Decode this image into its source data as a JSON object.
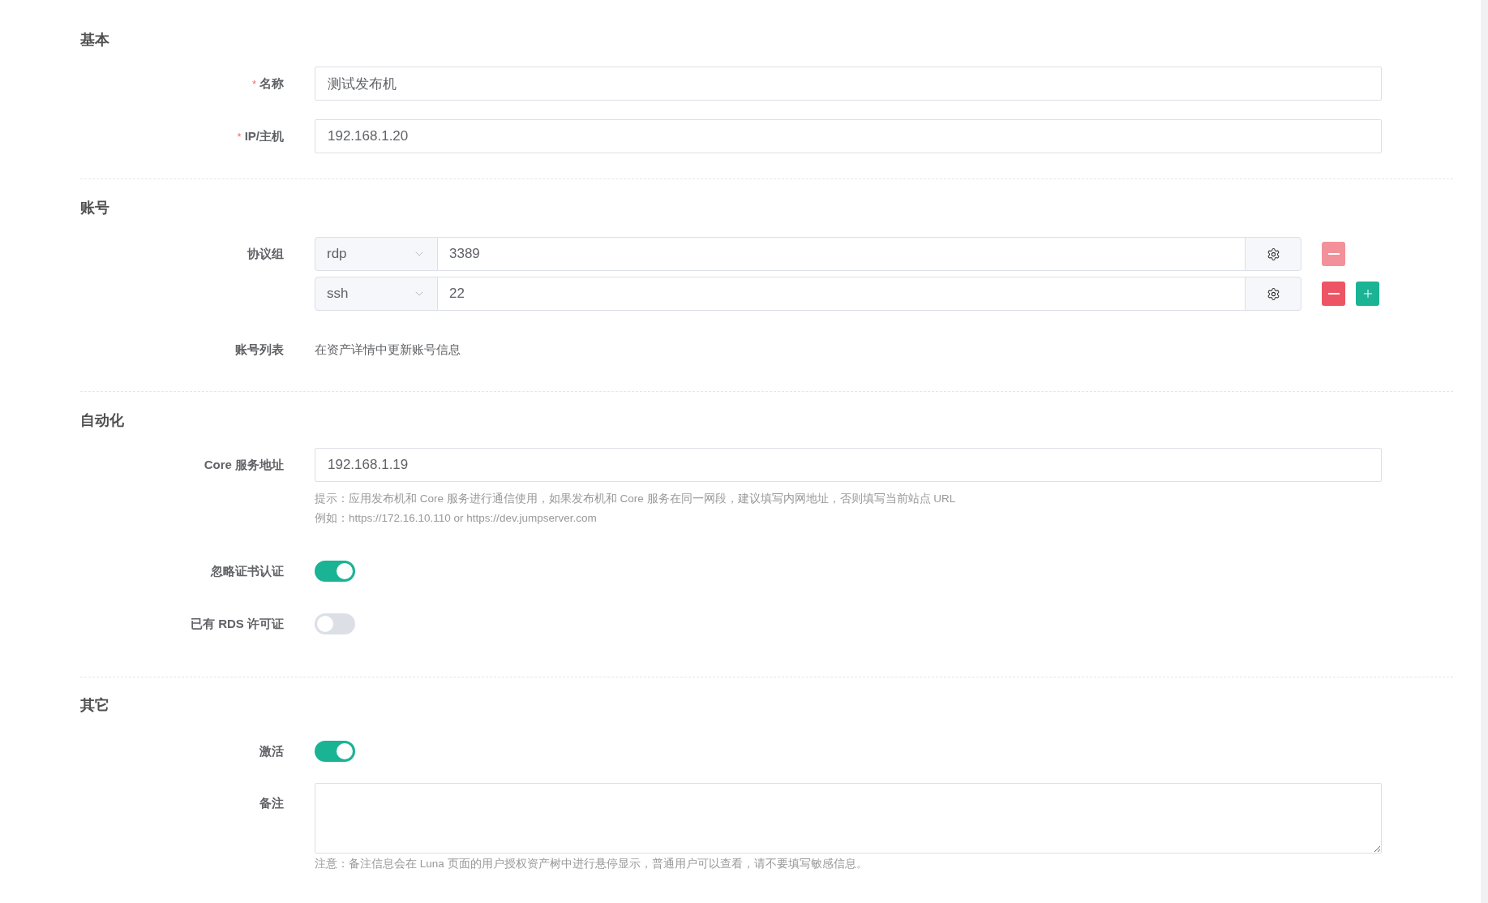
{
  "sections": [
    {
      "title": "基本",
      "fields": [
        {
          "kind": "text",
          "mark": "*",
          "label": "名称",
          "value": "测试发布机"
        },
        {
          "kind": "text",
          "mark": "*",
          "label": "IP/主机",
          "value": "192.168.1.20"
        }
      ]
    },
    {
      "title": "账号",
      "fields": [
        {
          "kind": "protocols",
          "label": "协议组",
          "rows": [
            {
              "name": "rdp",
              "port": "3389",
              "remove_disabled": true,
              "add": false
            },
            {
              "name": "ssh",
              "port": "22",
              "remove_disabled": false,
              "add": true
            }
          ]
        },
        {
          "kind": "static",
          "label": "账号列表",
          "value": "在资产详情中更新账号信息"
        }
      ]
    },
    {
      "title": "自动化",
      "fields": [
        {
          "kind": "text",
          "label": "Core 服务地址",
          "value": "192.168.1.19",
          "hints": [
            "提示：应用发布机和 Core 服务进行通信使用，如果发布机和 Core 服务在同一网段，建议填写内网地址，否则填写当前站点 URL",
            "例如：https://172.16.10.110 or https://dev.jumpserver.com"
          ]
        },
        {
          "kind": "toggle",
          "label": "忽略证书认证",
          "on": true
        },
        {
          "kind": "toggle",
          "label": "已有 RDS 许可证",
          "on": false
        }
      ]
    },
    {
      "title": "其它",
      "fields": [
        {
          "kind": "toggle",
          "label": "激活",
          "on": true
        },
        {
          "kind": "textarea",
          "label": "备注",
          "hints": [
            "注意：备注信息会在 Luna 页面的用户授权资产树中进行悬停显示，普通用户可以查看，请不要填写敏感信息。"
          ]
        }
      ]
    }
  ]
}
